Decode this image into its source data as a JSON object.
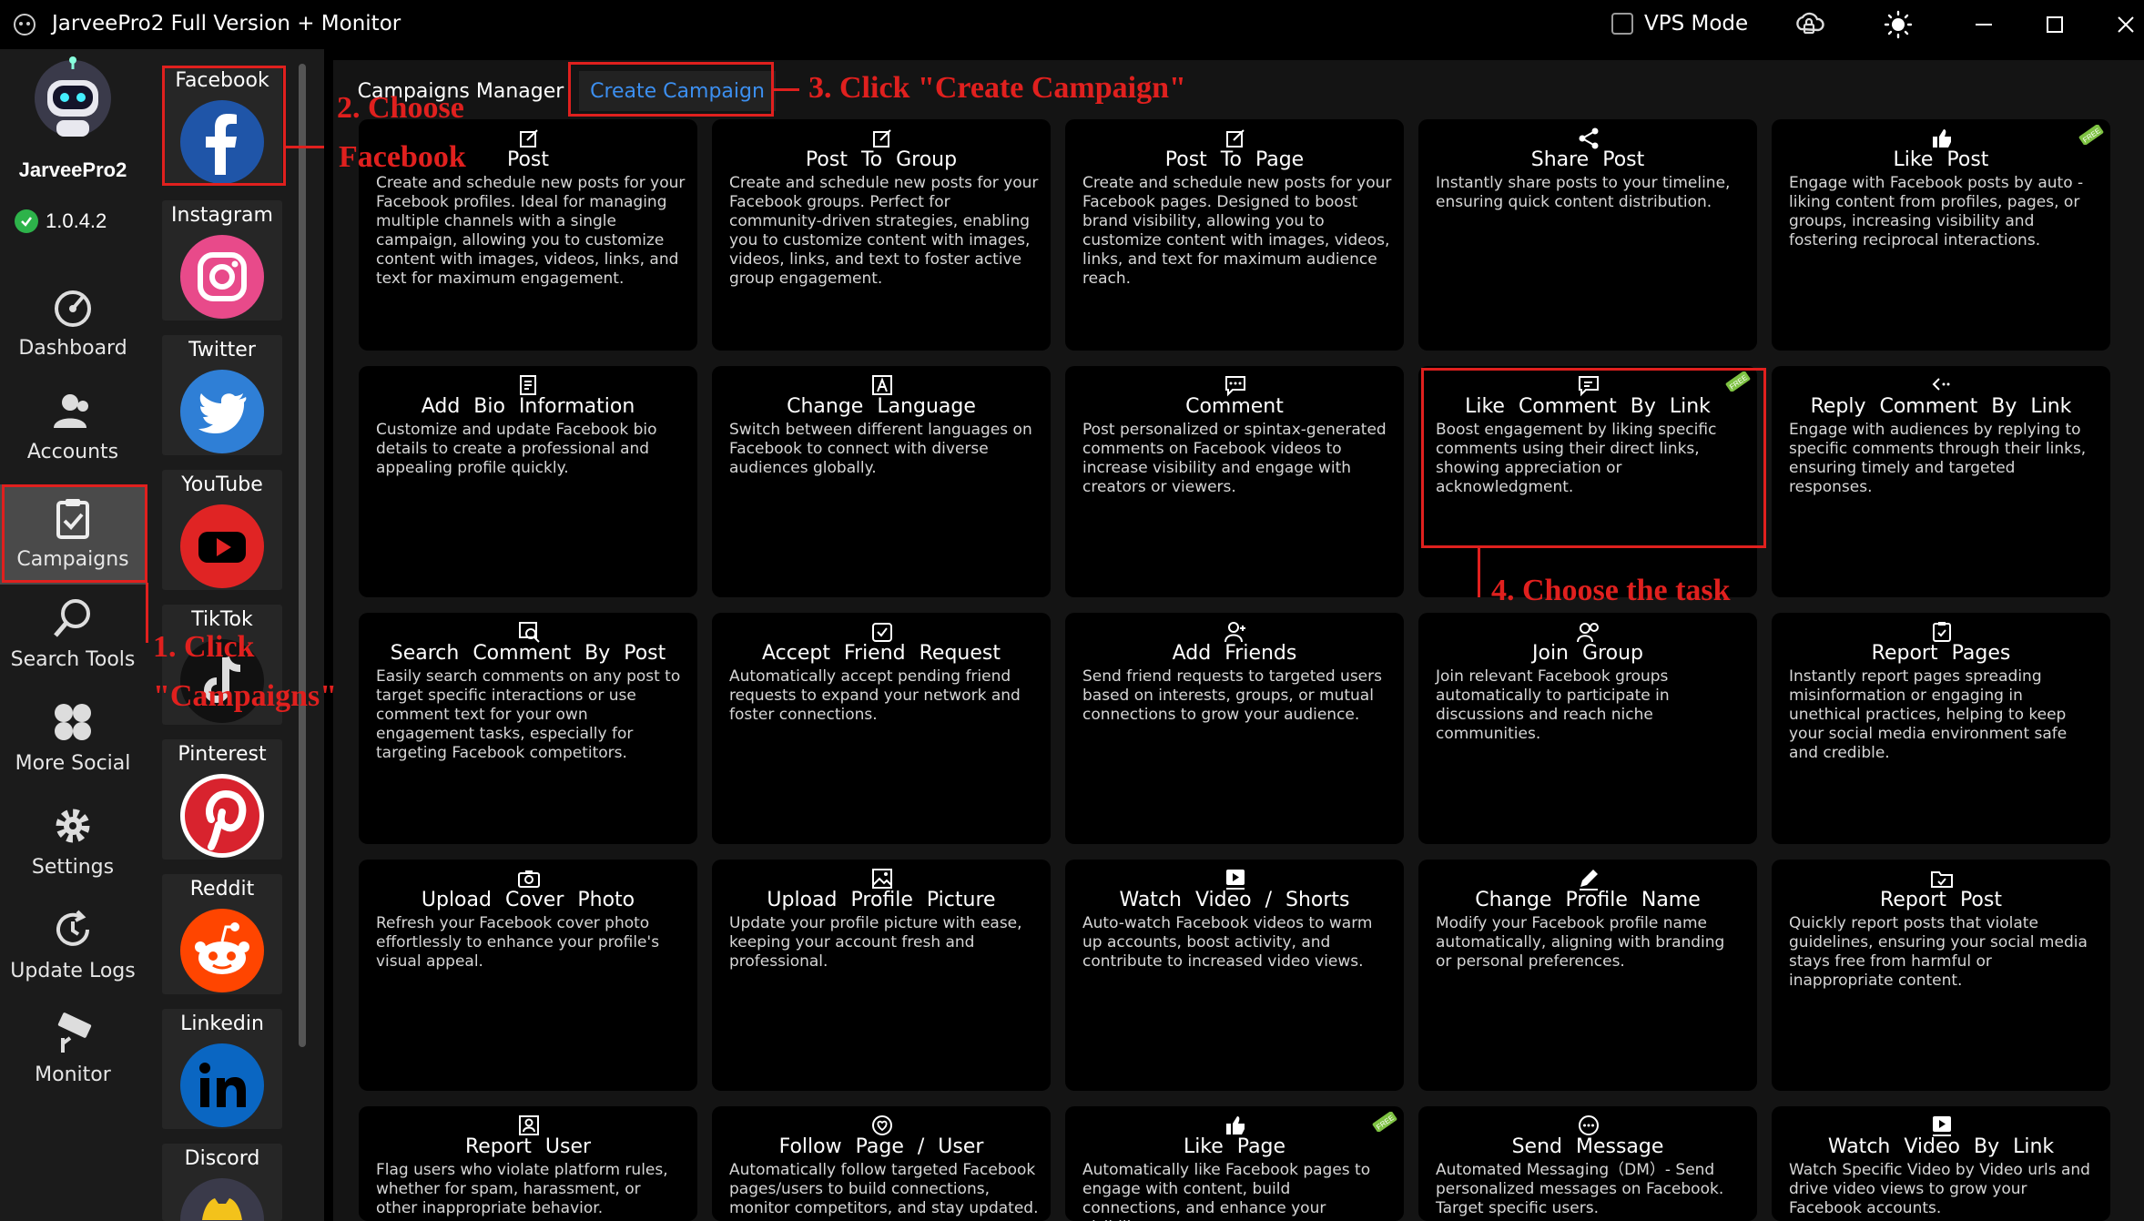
{
  "window": {
    "title": "JarveePro2 Full Version + Monitor",
    "vps_label": "VPS Mode"
  },
  "brand": {
    "name": "JarveePro2",
    "version": "1.0.4.2"
  },
  "nav": [
    {
      "label": "Dashboard",
      "icon": "dashboard-icon"
    },
    {
      "label": "Accounts",
      "icon": "accounts-icon"
    },
    {
      "label": "Campaigns",
      "icon": "campaigns-icon",
      "active": true
    },
    {
      "label": "Search Tools",
      "icon": "search-icon"
    },
    {
      "label": "More Social",
      "icon": "more-social-icon"
    },
    {
      "label": "Settings",
      "icon": "gear-icon"
    },
    {
      "label": "Update Logs",
      "icon": "update-logs-icon"
    },
    {
      "label": "Monitor",
      "icon": "monitor-icon"
    }
  ],
  "social": [
    {
      "name": "Facebook",
      "color": "#1f55a8"
    },
    {
      "name": "Instagram",
      "color": "#e84a8a"
    },
    {
      "name": "Twitter",
      "color": "#2f7fd6"
    },
    {
      "name": "YouTube",
      "color": "#e02424"
    },
    {
      "name": "TikTok",
      "color": "#111111"
    },
    {
      "name": "Pinterest",
      "color": "#d8232e"
    },
    {
      "name": "Reddit",
      "color": "#ff4500"
    },
    {
      "name": "Linkedin",
      "color": "#0a66c2"
    },
    {
      "name": "Discord",
      "color": "#f3c21b"
    }
  ],
  "tabs": {
    "manager": "Campaigns Manager",
    "create": "Create Campaign"
  },
  "cards": [
    {
      "title": "Post",
      "icon": "edit-icon",
      "desc": "Create and schedule new posts for your Facebook profiles. Ideal for managing multiple channels with a single campaign, allowing you to customize content with images, videos, links, and text for maximum engagement."
    },
    {
      "title": "Post To Group",
      "icon": "edit-icon",
      "desc": "Create and schedule new posts for your Facebook groups. Perfect for community-driven strategies, enabling you to customize content with images, videos, links, and text to foster active group engagement."
    },
    {
      "title": "Post To Page",
      "icon": "edit-icon",
      "desc": "Create and schedule new posts for your Facebook pages. Designed to boost brand visibility, allowing you to customize content with images, videos, links, and text for maximum audience reach."
    },
    {
      "title": "Share Post",
      "icon": "share-icon",
      "desc": "Instantly share posts to your timeline, ensuring quick content distribution."
    },
    {
      "title": "Like Post",
      "icon": "thumbs-up-icon",
      "free": true,
      "desc": "Engage with Facebook posts by auto -liking content from profiles, pages, or groups, increasing visibility and fostering reciprocal interactions."
    },
    {
      "title": "Add Bio Information",
      "icon": "bio-icon",
      "desc": "Customize and update Facebook bio details to create a professional and appealing profile quickly."
    },
    {
      "title": "Change Language",
      "icon": "language-icon",
      "desc": "Switch between different languages on Facebook to connect with diverse audiences globally."
    },
    {
      "title": "Comment",
      "icon": "comment-icon",
      "desc": "Post personalized or spintax-generated comments on Facebook videos to increase visibility and engage with creators or viewers."
    },
    {
      "title": "Like Comment By Link",
      "icon": "like-comment-icon",
      "free": true,
      "desc": "Boost engagement by liking specific comments using their direct links, showing appreciation or acknowledgment."
    },
    {
      "title": "Reply Comment By Link",
      "icon": "reply-icon",
      "desc": "Engage with audiences by replying to specific comments through their links, ensuring timely and targeted responses."
    },
    {
      "title": "Search Comment By Post",
      "icon": "search-comment-icon",
      "desc": "Easily search comments on any post to target specific interactions or use comment text for your own engagement tasks, especially for targeting Facebook competitors."
    },
    {
      "title": "Accept Friend Request",
      "icon": "accept-icon",
      "desc": "Automatically accept pending friend requests to expand your network and foster connections."
    },
    {
      "title": "Add Friends",
      "icon": "add-friend-icon",
      "desc": "Send friend requests to targeted users based on interests, groups, or mutual connections to grow your audience."
    },
    {
      "title": "Join Group",
      "icon": "join-group-icon",
      "desc": "Join relevant Facebook groups automatically to participate in discussions and reach niche communities."
    },
    {
      "title": "Report Pages",
      "icon": "report-icon",
      "desc": "Instantly report pages spreading misinformation or engaging in unethical practices, helping to keep your social media environment safe and credible."
    },
    {
      "title": "Upload Cover Photo",
      "icon": "camera-icon",
      "desc": "Refresh your Facebook cover photo effortlessly to enhance your profile's visual appeal."
    },
    {
      "title": "Upload Profile Picture",
      "icon": "picture-icon",
      "desc": "Update your profile picture with ease, keeping your account fresh and professional."
    },
    {
      "title": "Watch Video / Shorts",
      "icon": "video-icon",
      "desc": "Auto-watch Facebook videos to warm up accounts, boost activity, and contribute to increased video views."
    },
    {
      "title": "Change Profile Name",
      "icon": "pen-icon",
      "desc": "Modify your Facebook profile name automatically, aligning with branding or personal preferences."
    },
    {
      "title": "Report Post",
      "icon": "folder-icon",
      "desc": "Quickly report posts that violate guidelines, ensuring your social media stays free from harmful or inappropriate content."
    },
    {
      "title": "Report User",
      "icon": "report-user-icon",
      "desc": "Flag users who violate platform rules, whether for spam, harassment, or other inappropriate behavior."
    },
    {
      "title": "Follow Page / User",
      "icon": "follow-icon",
      "desc": "Automatically follow targeted Facebook pages/users to build connections, monitor competitors, and stay updated."
    },
    {
      "title": "Like Page",
      "icon": "thumbs-up-icon",
      "free": true,
      "desc": "Automatically like Facebook pages to engage with content, build connections, and enhance your visibility."
    },
    {
      "title": "Send Message",
      "icon": "message-icon",
      "desc": "Automated Messaging（DM）- Send personalized messages on Facebook. Target specific users."
    },
    {
      "title": "Watch Video By Link",
      "icon": "video-icon",
      "desc": "Watch Specific Video by Video urls and drive video views to grow your Facebook accounts."
    }
  ],
  "free_badge": "FREE",
  "annotations": {
    "step1a": "1. Click",
    "step1b": "\"Campaigns\"",
    "step2a": "2. Choose",
    "step2b": "Facebook",
    "step3": "3. Click \"Create Campaign\"",
    "step4": "4. Choose the task"
  },
  "colors": {
    "accent": "#3c8ff0",
    "annotation": "#e0201e",
    "nav_active": "#4a4a4a"
  }
}
